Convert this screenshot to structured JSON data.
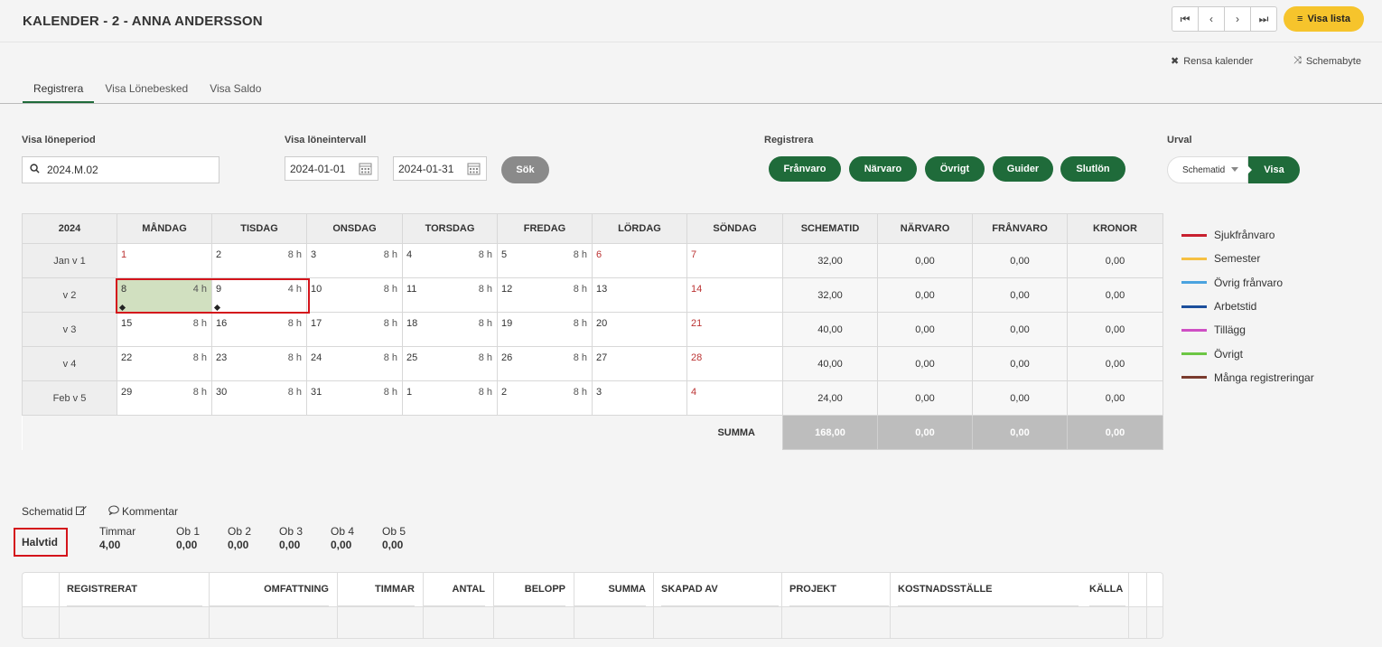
{
  "header": {
    "title": "KALENDER - 2 - ANNA ANDERSSON",
    "nav_icons": [
      "first-icon",
      "prev-icon",
      "next-icon",
      "last-icon"
    ],
    "visa_lista_label": "Visa lista"
  },
  "actions": {
    "rensa_label": "Rensa kalender",
    "schemabyte_label": "Schemabyte"
  },
  "tabs": [
    {
      "label": "Registrera",
      "active": true
    },
    {
      "label": "Visa Lönebesked",
      "active": false
    },
    {
      "label": "Visa Saldo",
      "active": false
    }
  ],
  "filters": {
    "loneperiod_label": "Visa löneperiod",
    "loneperiod_value": "2024.M.02",
    "intervall_label": "Visa löneintervall",
    "from_date": "2024-01-01",
    "to_date": "2024-01-31",
    "sok_label": "Sök",
    "registrera_label": "Registrera",
    "register_buttons": [
      "Frånvaro",
      "Närvaro",
      "Övrigt",
      "Guider",
      "Slutlön"
    ],
    "urval_label": "Urval",
    "urval_value": "Schematid",
    "visa_label": "Visa"
  },
  "calendar": {
    "year": "2024",
    "day_headers": [
      "MÅNDAG",
      "TISDAG",
      "ONSDAG",
      "TORSDAG",
      "FREDAG",
      "LÖRDAG",
      "SÖNDAG"
    ],
    "sum_headers": [
      "SCHEMATID",
      "NÄRVARO",
      "FRÅNVARO",
      "KRONOR"
    ],
    "weeks": [
      {
        "label": "Jan v 1",
        "days": [
          {
            "n": "1",
            "h": "",
            "red": true
          },
          {
            "n": "2",
            "h": "8 h"
          },
          {
            "n": "3",
            "h": "8 h"
          },
          {
            "n": "4",
            "h": "8 h"
          },
          {
            "n": "5",
            "h": "8 h"
          },
          {
            "n": "6",
            "h": "",
            "red": true
          },
          {
            "n": "7",
            "h": "",
            "red": true
          }
        ],
        "sums": [
          "32,00",
          "0,00",
          "0,00",
          "0,00"
        ]
      },
      {
        "label": "v 2",
        "days": [
          {
            "n": "8",
            "h": "4 h",
            "hl": true,
            "dot": true
          },
          {
            "n": "9",
            "h": "4 h",
            "dot": true
          },
          {
            "n": "10",
            "h": "8 h"
          },
          {
            "n": "11",
            "h": "8 h"
          },
          {
            "n": "12",
            "h": "8 h"
          },
          {
            "n": "13",
            "h": ""
          },
          {
            "n": "14",
            "h": "",
            "red": true
          }
        ],
        "sums": [
          "32,00",
          "0,00",
          "0,00",
          "0,00"
        ]
      },
      {
        "label": "v 3",
        "days": [
          {
            "n": "15",
            "h": "8 h"
          },
          {
            "n": "16",
            "h": "8 h"
          },
          {
            "n": "17",
            "h": "8 h"
          },
          {
            "n": "18",
            "h": "8 h"
          },
          {
            "n": "19",
            "h": "8 h"
          },
          {
            "n": "20",
            "h": ""
          },
          {
            "n": "21",
            "h": "",
            "red": true
          }
        ],
        "sums": [
          "40,00",
          "0,00",
          "0,00",
          "0,00"
        ]
      },
      {
        "label": "v 4",
        "days": [
          {
            "n": "22",
            "h": "8 h"
          },
          {
            "n": "23",
            "h": "8 h"
          },
          {
            "n": "24",
            "h": "8 h"
          },
          {
            "n": "25",
            "h": "8 h"
          },
          {
            "n": "26",
            "h": "8 h"
          },
          {
            "n": "27",
            "h": ""
          },
          {
            "n": "28",
            "h": "",
            "red": true
          }
        ],
        "sums": [
          "40,00",
          "0,00",
          "0,00",
          "0,00"
        ]
      },
      {
        "label": "Feb v 5",
        "days": [
          {
            "n": "29",
            "h": "8 h"
          },
          {
            "n": "30",
            "h": "8 h"
          },
          {
            "n": "31",
            "h": "8 h"
          },
          {
            "n": "1",
            "h": "8 h"
          },
          {
            "n": "2",
            "h": "8 h"
          },
          {
            "n": "3",
            "h": ""
          },
          {
            "n": "4",
            "h": "",
            "red": true
          }
        ],
        "sums": [
          "24,00",
          "0,00",
          "0,00",
          "0,00"
        ]
      }
    ],
    "summa_label": "SUMMA",
    "summa_values": [
      "168,00",
      "0,00",
      "0,00",
      "0,00"
    ]
  },
  "legend": [
    {
      "label": "Sjukfrånvaro",
      "color": "#c8202f"
    },
    {
      "label": "Semester",
      "color": "#f6c042"
    },
    {
      "label": "Övrig frånvaro",
      "color": "#4aa3df"
    },
    {
      "label": "Arbetstid",
      "color": "#1c4f9c"
    },
    {
      "label": "Tillägg",
      "color": "#cf4fc4"
    },
    {
      "label": "Övrigt",
      "color": "#6cc644"
    },
    {
      "label": "Många registreringar",
      "color": "#7a3b2e"
    }
  ],
  "schedule": {
    "schematid_label": "Schematid",
    "kommentar_label": "Kommentar",
    "name": "Halvtid",
    "stats": [
      {
        "label": "Timmar",
        "value": "4,00"
      },
      {
        "label": "Ob 1",
        "value": "0,00"
      },
      {
        "label": "Ob 2",
        "value": "0,00"
      },
      {
        "label": "Ob 3",
        "value": "0,00"
      },
      {
        "label": "Ob 4",
        "value": "0,00"
      },
      {
        "label": "Ob 5",
        "value": "0,00"
      }
    ]
  },
  "registrations": {
    "columns": [
      "REGISTRERAT",
      "OMFATTNING",
      "TIMMAR",
      "ANTAL",
      "BELOPP",
      "SUMMA",
      "SKAPAD AV",
      "PROJEKT",
      "KOSTNADSSTÄLLE",
      "KÄLLA"
    ]
  }
}
